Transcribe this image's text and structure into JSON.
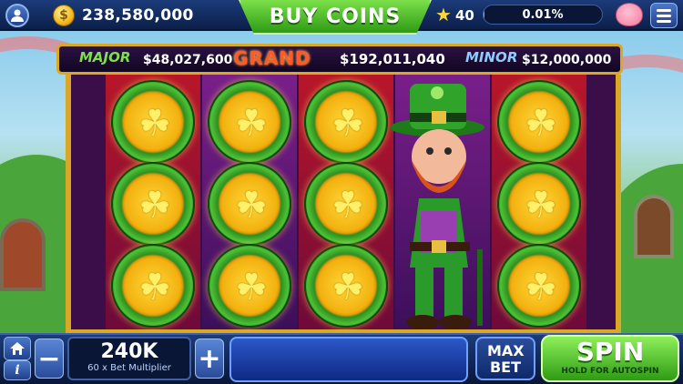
{
  "topbar": {
    "balance": "238,580,000",
    "buy_label": "BUY COINS",
    "level": "40",
    "progress_text": "0.01%",
    "progress_fraction": 0.0001
  },
  "jackpots": {
    "major": {
      "name": "MAJOR",
      "value": "$48,027,600"
    },
    "grand": {
      "name": "GRAND",
      "value": "$192,011,040"
    },
    "minor": {
      "name": "MINOR",
      "value": "$12,000,000"
    }
  },
  "bet": {
    "value": "240K",
    "multiplier": "60 x Bet Multiplier",
    "minus": "−",
    "plus": "+"
  },
  "buttons": {
    "max_bet": "MAX BET",
    "spin": "SPIN",
    "spin_hint": "HOLD FOR AUTOSPIN",
    "home_icon": "home-icon",
    "info_icon": "info-icon",
    "info_glyph": "i"
  },
  "colors": {
    "accent_green": "#2e9b14",
    "gold": "#d9a826",
    "navy": "#1b3b7a"
  }
}
